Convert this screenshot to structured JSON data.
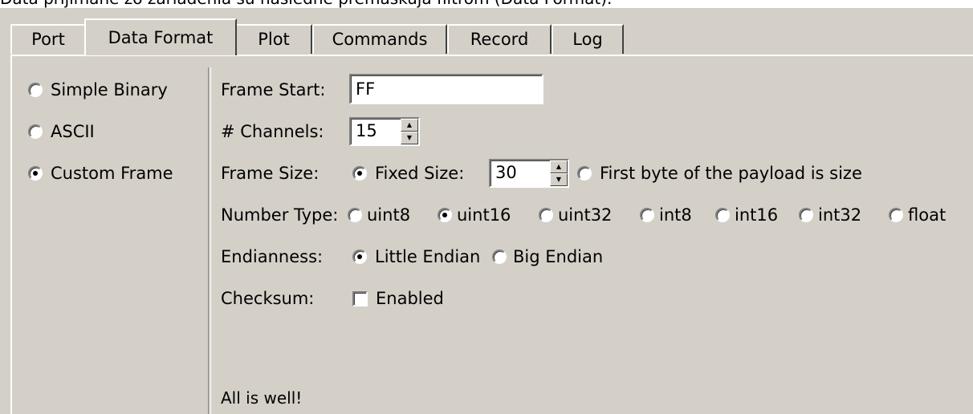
{
  "caption": "Dáta prijímané zo zariadenia sú následne premaskuja filtrom (Data Format).",
  "tabs": [
    {
      "label": "Port"
    },
    {
      "label": "Data Format"
    },
    {
      "label": "Plot"
    },
    {
      "label": "Commands"
    },
    {
      "label": "Record"
    },
    {
      "label": "Log"
    }
  ],
  "active_tab": "Data Format",
  "format_modes": [
    {
      "label": "Simple Binary",
      "checked": false
    },
    {
      "label": "ASCII",
      "checked": false
    },
    {
      "label": "Custom Frame",
      "checked": true
    }
  ],
  "frame_start": {
    "label": "Frame Start:",
    "value": "FF"
  },
  "channels": {
    "label": "# Channels:",
    "value": "15"
  },
  "frame_size": {
    "label": "Frame Size:",
    "fixed_label": "Fixed Size:",
    "fixed_checked": true,
    "fixed_value": "30",
    "first_byte_label": "First byte of the payload is size",
    "first_byte_checked": false
  },
  "number_type": {
    "label": "Number Type:",
    "options": [
      {
        "label": "uint8",
        "checked": false
      },
      {
        "label": "uint16",
        "checked": true
      },
      {
        "label": "uint32",
        "checked": false
      },
      {
        "label": "int8",
        "checked": false
      },
      {
        "label": "int16",
        "checked": false
      },
      {
        "label": "int32",
        "checked": false
      },
      {
        "label": "float",
        "checked": false
      }
    ]
  },
  "endianness": {
    "label": "Endianness:",
    "options": [
      {
        "label": "Little Endian",
        "checked": true
      },
      {
        "label": "Big Endian",
        "checked": false
      }
    ]
  },
  "checksum": {
    "label": "Checksum:",
    "enabled_label": "Enabled",
    "checked": false
  },
  "status": "All is well!",
  "colors": {
    "face": "#d4d0c8",
    "highlight": "#ffffff",
    "shadow": "#808080"
  }
}
